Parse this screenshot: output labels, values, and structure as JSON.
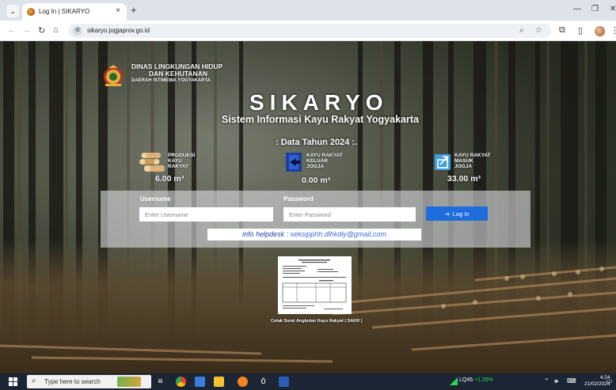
{
  "browser": {
    "tab_title": "Log In | SIKARYO",
    "url": "sikaryo.jogjaprov.go.id",
    "tab_close": "×",
    "tab_new": "+"
  },
  "site": {
    "agency_line1": "DINAS LINGKUNGAN HIDUP",
    "agency_line2": "DAN KEHUTANAN",
    "agency_line3": "DAERAH ISTIMEWA YOGYAKARTA",
    "title": "SIKARYO",
    "subtitle": "Sistem Informasi Kayu Rakyat Yogyakarta",
    "year_title": ": Data Tahun 2024 :."
  },
  "stats": [
    {
      "label": "PRODUKSI\nKAYU\nRAKYAT",
      "value": "6.00 m³",
      "icon": "log-pile-icon"
    },
    {
      "label": "KAYU RAKYAT\nKELUAR\nJOGJA",
      "value": "0.00 m³",
      "icon": "exit-door-icon"
    },
    {
      "label": "KAYU RAKYAT\nMASUK\nJOGJA",
      "value": "33.00 m³",
      "icon": "enter-box-icon"
    }
  ],
  "login": {
    "username_label": "Username",
    "username_placeholder": "Enter Username",
    "username_value": "",
    "password_label": "Password",
    "password_placeholder": "Enter Password",
    "password_value": "",
    "button_label": "Log In",
    "button_color": "#1f6cdd"
  },
  "helpdesk": {
    "prefix": "info helpdesk :",
    "email": "seksipphh.dlhkdiy@gmail.com"
  },
  "document": {
    "caption": "Cetak Surat Angkutan Kayu Rakyat ( SAKR )"
  },
  "taskbar": {
    "search_placeholder": "Type here to search",
    "stock_name": "LQ45",
    "stock_change": "+1.26%",
    "stock_change_color": "#30d158",
    "time": "4:24",
    "date": "21/02/2024"
  }
}
